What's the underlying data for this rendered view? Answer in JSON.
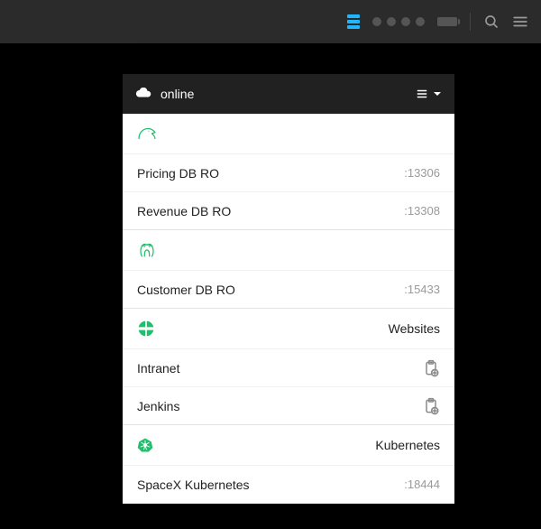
{
  "accent": "#1fb6ff",
  "green": "#1fbf6b",
  "titlebar": {
    "dot_count": 4
  },
  "panel": {
    "status_label": "online",
    "sections": [
      {
        "id": "mysql",
        "head_label": "",
        "items": [
          {
            "name": "Pricing DB RO",
            "port": ":13306"
          },
          {
            "name": "Revenue DB RO",
            "port": ":13308"
          }
        ]
      },
      {
        "id": "postgres",
        "head_label": "",
        "items": [
          {
            "name": "Customer DB RO",
            "port": ":15433"
          }
        ]
      },
      {
        "id": "websites",
        "head_label": "Websites",
        "items": [
          {
            "name": "Intranet",
            "action": "clipboard-add"
          },
          {
            "name": "Jenkins",
            "action": "clipboard-add"
          }
        ]
      },
      {
        "id": "kubernetes",
        "head_label": "Kubernetes",
        "items": [
          {
            "name": "SpaceX Kubernetes",
            "port": ":18444"
          }
        ]
      }
    ]
  }
}
